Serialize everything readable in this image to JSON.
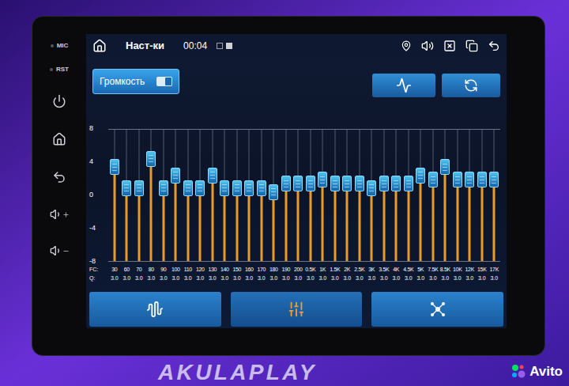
{
  "watermark": {
    "brand": "AKULAPLAY",
    "site": "Avito"
  },
  "bezel": {
    "labels": [
      "MIC",
      "RST"
    ]
  },
  "status_bar": {
    "title": "Наст-ки",
    "time": "00:04"
  },
  "volume_toggle": {
    "label": "Громкость",
    "on": true
  },
  "equalizer": {
    "y_ticks": [
      "8",
      "4",
      "0",
      "-4",
      "-8"
    ],
    "fc_label": "FC:",
    "q_label": "Q:",
    "bands": [
      {
        "freq": "30",
        "q": "3.0",
        "gain": 3.5
      },
      {
        "freq": "60",
        "q": "3.0",
        "gain": 1
      },
      {
        "freq": "70",
        "q": "3.0",
        "gain": 1
      },
      {
        "freq": "80",
        "q": "3.0",
        "gain": 4.5
      },
      {
        "freq": "90",
        "q": "3.0",
        "gain": 1
      },
      {
        "freq": "100",
        "q": "3.0",
        "gain": 2.5
      },
      {
        "freq": "110",
        "q": "3.0",
        "gain": 1
      },
      {
        "freq": "120",
        "q": "3.0",
        "gain": 1
      },
      {
        "freq": "130",
        "q": "3.0",
        "gain": 2.5
      },
      {
        "freq": "140",
        "q": "3.0",
        "gain": 1
      },
      {
        "freq": "150",
        "q": "3.0",
        "gain": 1
      },
      {
        "freq": "160",
        "q": "3.0",
        "gain": 1
      },
      {
        "freq": "170",
        "q": "3.0",
        "gain": 1
      },
      {
        "freq": "180",
        "q": "3.0",
        "gain": 0.5
      },
      {
        "freq": "190",
        "q": "3.0",
        "gain": 1.5
      },
      {
        "freq": "200",
        "q": "3.0",
        "gain": 1.5
      },
      {
        "freq": "0.5K",
        "q": "3.0",
        "gain": 1.5
      },
      {
        "freq": "1K",
        "q": "3.0",
        "gain": 2
      },
      {
        "freq": "1.5K",
        "q": "3.0",
        "gain": 1.5
      },
      {
        "freq": "2K",
        "q": "3.0",
        "gain": 1.5
      },
      {
        "freq": "2.5K",
        "q": "3.0",
        "gain": 1.5
      },
      {
        "freq": "3K",
        "q": "3.0",
        "gain": 1
      },
      {
        "freq": "3.5K",
        "q": "3.0",
        "gain": 1.5
      },
      {
        "freq": "4K",
        "q": "3.0",
        "gain": 1.5
      },
      {
        "freq": "4.5K",
        "q": "3.0",
        "gain": 1.5
      },
      {
        "freq": "5K",
        "q": "3.0",
        "gain": 2.5
      },
      {
        "freq": "7.5K",
        "q": "3.0",
        "gain": 2
      },
      {
        "freq": "8.5K",
        "q": "3.0",
        "gain": 3.5
      },
      {
        "freq": "10K",
        "q": "3.0",
        "gain": 2
      },
      {
        "freq": "12K",
        "q": "3.0",
        "gain": 2
      },
      {
        "freq": "15K",
        "q": "3.0",
        "gain": 2
      },
      {
        "freq": "17K",
        "q": "3.0",
        "gain": 2
      }
    ]
  },
  "bottom_tabs": [
    {
      "selected": false
    },
    {
      "selected": true
    },
    {
      "selected": false
    }
  ]
}
